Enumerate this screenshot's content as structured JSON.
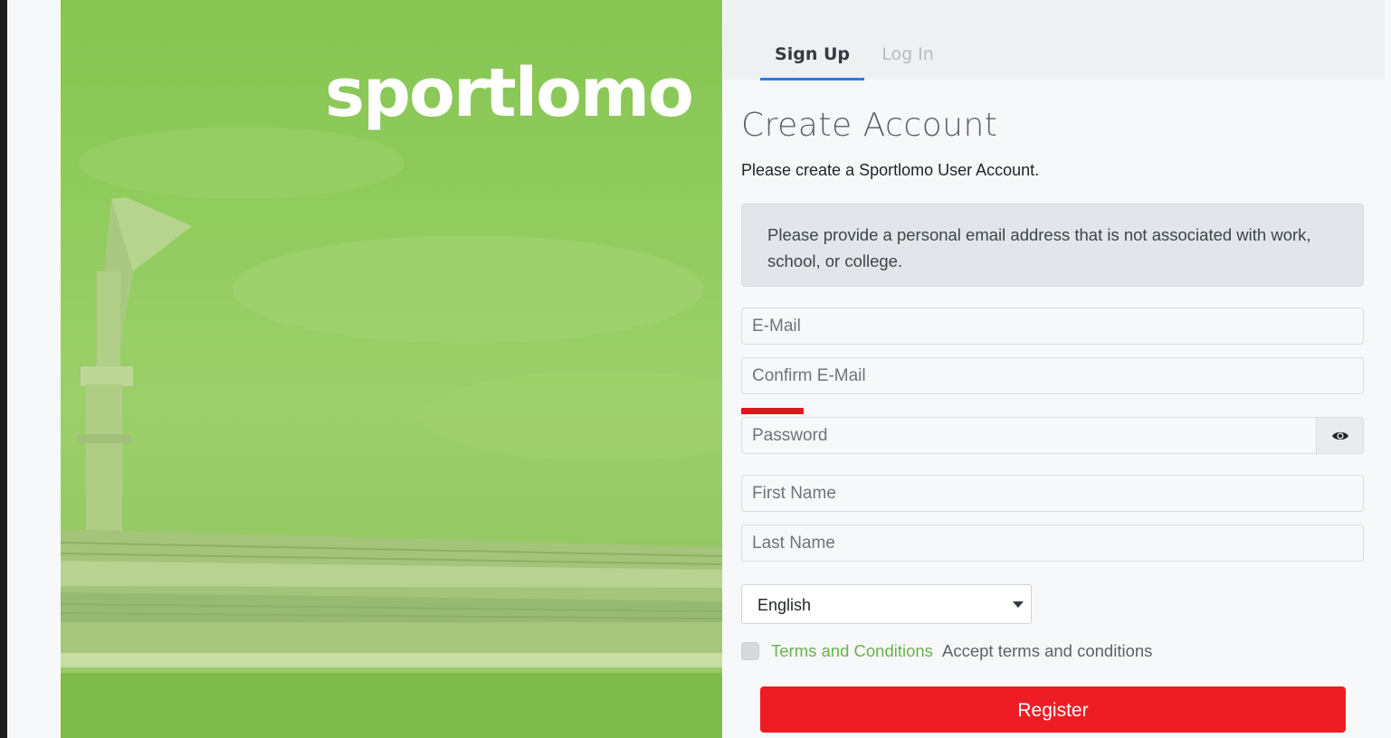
{
  "brand": {
    "logo_text": "sportlomo"
  },
  "tabs": [
    {
      "label": "Sign Up",
      "active": true
    },
    {
      "label": "Log In",
      "active": false
    }
  ],
  "form": {
    "title": "Create Account",
    "subtitle": "Please create a Sportlomo User Account.",
    "notice": "Please provide a personal email address that is not associated with work, school, or college.",
    "email_placeholder": "E-Mail",
    "confirm_email_placeholder": "Confirm E-Mail",
    "password_placeholder": "Password",
    "password_toggle_icon": "eye-icon",
    "first_name_placeholder": "First Name",
    "last_name_placeholder": "Last Name",
    "language_selected": "English",
    "terms_link": "Terms and Conditions",
    "terms_text": "Accept terms and conditions",
    "terms_checked": false,
    "register_label": "Register"
  },
  "colors": {
    "accent_blue": "#2b7ae0",
    "register_red": "#ee1c25",
    "terms_green": "#6ab04c",
    "hero_green": "#8fcb5c",
    "strength_red": "#e4141d"
  }
}
